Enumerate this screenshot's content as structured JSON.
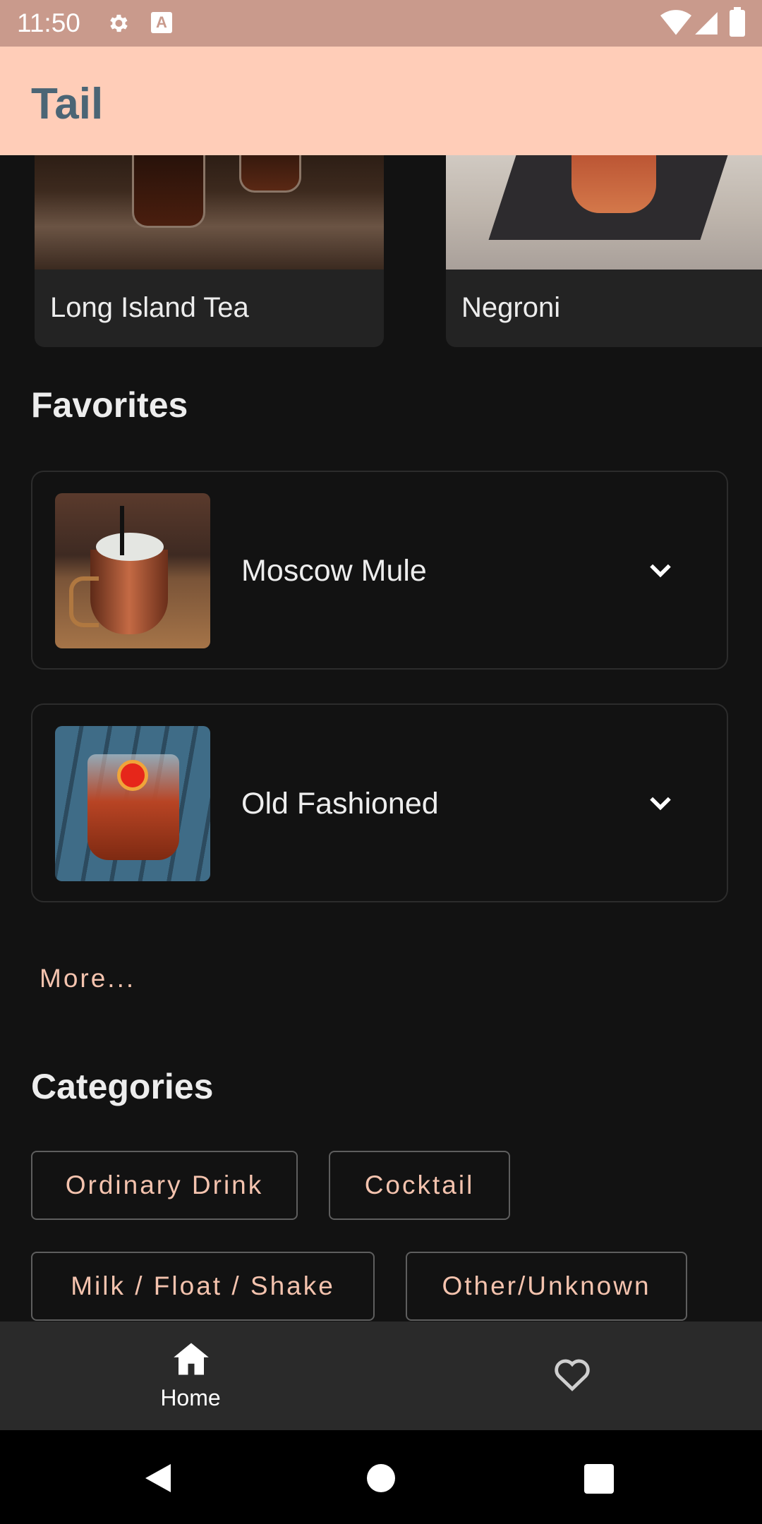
{
  "status_bar": {
    "time": "11:50",
    "badge_letter": "A"
  },
  "app_bar": {
    "title": "Tail"
  },
  "drinks_row": [
    {
      "name": "Long Island Tea"
    },
    {
      "name": "Negroni"
    }
  ],
  "favorites": {
    "title": "Favorites",
    "items": [
      {
        "name": "Moscow Mule"
      },
      {
        "name": "Old Fashioned"
      }
    ],
    "more_label": "More..."
  },
  "categories": {
    "title": "Categories",
    "chips": [
      "Ordinary Drink",
      "Cocktail",
      "Milk / Float / Shake",
      "Other/Unknown"
    ]
  },
  "bottom_nav": {
    "home_label": "Home"
  },
  "colors": {
    "app_bar": "#ffcdb8",
    "status_bar": "#c99a8c",
    "accent": "#f4c3ae",
    "background": "#121212",
    "title_text": "#4b6575"
  }
}
